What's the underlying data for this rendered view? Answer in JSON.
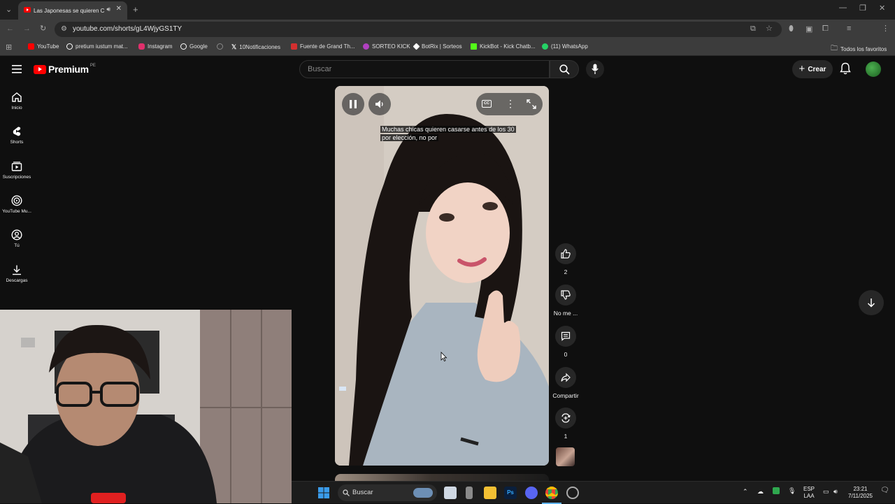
{
  "browser": {
    "tab_title": "Las Japonesas se quieren C",
    "url": "youtube.com/shorts/gL4WjyGS1TY",
    "bookmarks": [
      {
        "label": "YouTube",
        "color": "#ff0000"
      },
      {
        "label": "pretium iustum mat...",
        "color": "#ffffff"
      },
      {
        "label": "Instagram",
        "color": "#e1306c"
      },
      {
        "label": "Google",
        "color": "#ffffff"
      },
      {
        "label": "",
        "color": "#888888"
      },
      {
        "label": "10Notificaciones",
        "color": "#ffffff"
      },
      {
        "label": "Fuente de Grand Th...",
        "color": "#d32f2f"
      },
      {
        "label": "SORTEO KICK",
        "color": "#b040c0"
      },
      {
        "label": "BotRix | Sorteos",
        "color": "#ffffff"
      },
      {
        "label": "KickBot - Kick Chatb...",
        "color": "#53fc18"
      },
      {
        "label": "(11) WhatsApp",
        "color": "#25d366"
      }
    ],
    "all_bookmarks": "Todos los favoritos"
  },
  "youtube": {
    "logo": "Premium",
    "country": "PE",
    "search_placeholder": "Buscar",
    "create_label": "Crear",
    "sidebar": [
      {
        "label": "Inicio",
        "icon": "home-icon"
      },
      {
        "label": "Shorts",
        "icon": "shorts-icon"
      },
      {
        "label": "Suscripciones",
        "icon": "subscriptions-icon"
      },
      {
        "label": "YouTube Mu...",
        "icon": "youtube-music-icon"
      },
      {
        "label": "Tú",
        "icon": "you-icon"
      },
      {
        "label": "Descargas",
        "icon": "download-icon"
      }
    ],
    "short": {
      "caption": "Muchas chicas quieren casarse antes de los 30 por elección, no por"
    },
    "actions": {
      "likes": "2",
      "dislike_label": "No me ...",
      "comments": "0",
      "share_label": "Compartir",
      "remix": "1"
    }
  },
  "taskbar": {
    "search_label": "Buscar",
    "lang": "ESP",
    "layout": "LAA",
    "time": "23:21",
    "date": "7/11/2025"
  }
}
